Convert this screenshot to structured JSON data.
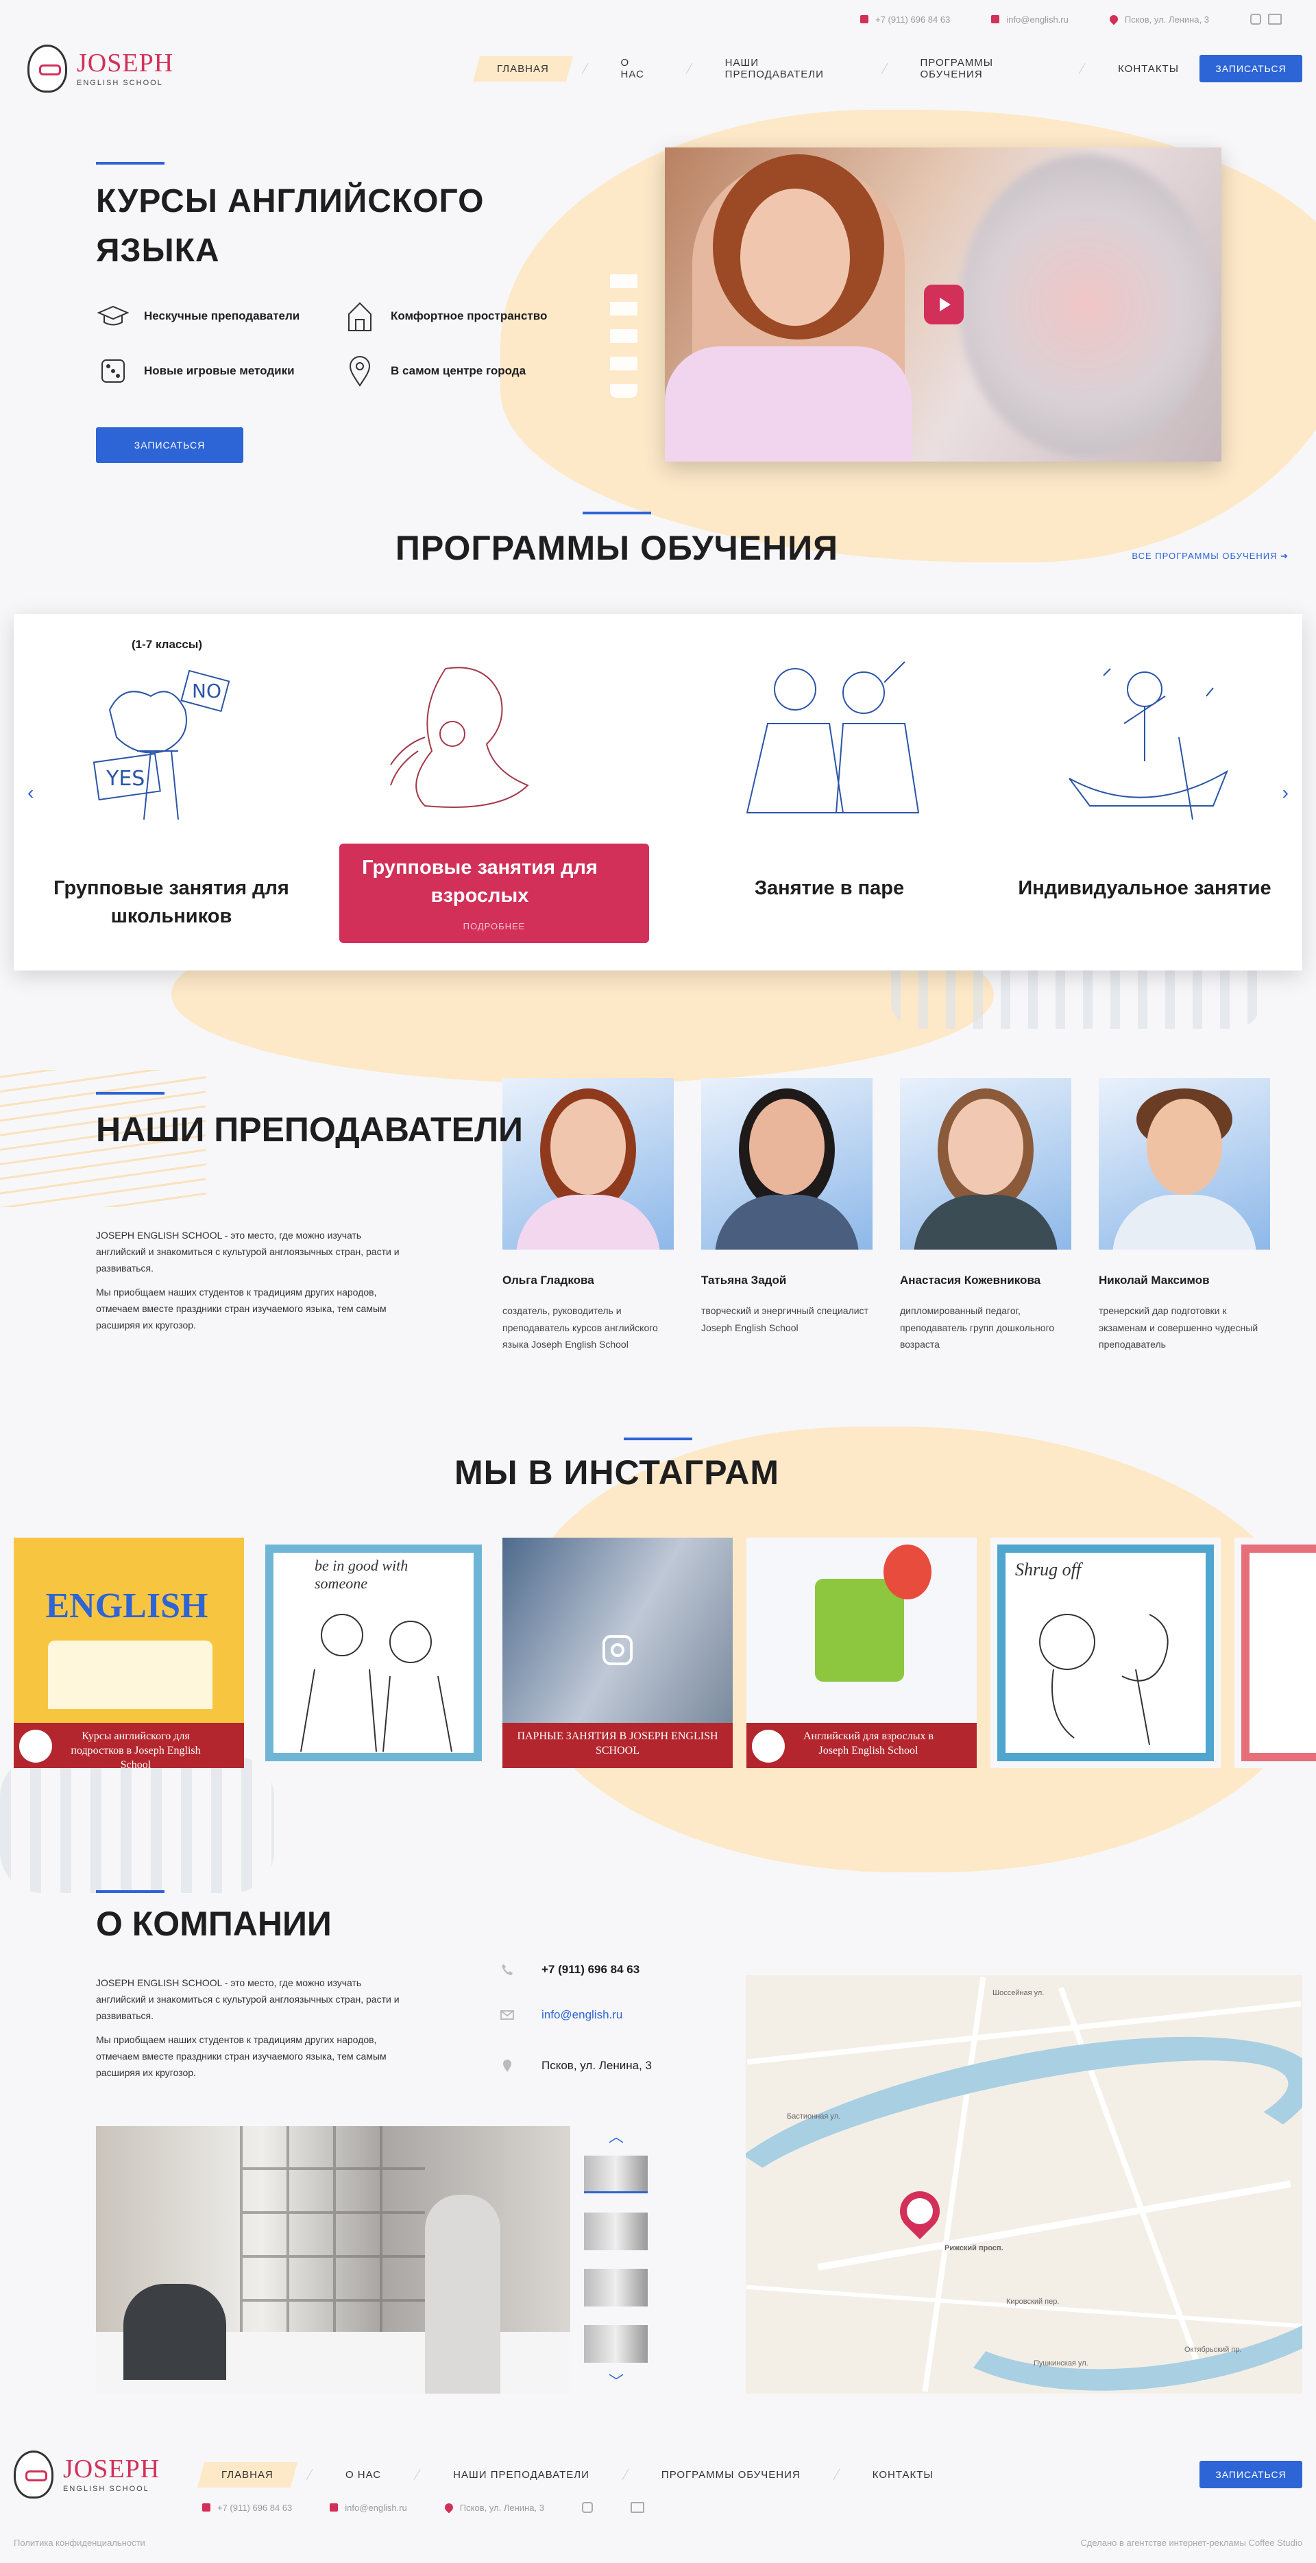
{
  "topbar": {
    "phone": "+7 (911) 696 84 63",
    "email": "info@english.ru",
    "address": "Псков, ул. Ленина, 3"
  },
  "logo": {
    "name": "JOSEPH",
    "sub": "ENGLISH SCHOOL"
  },
  "nav": [
    "Главная",
    "О нас",
    "Наши преподаватели",
    "Программы обучения",
    "Контакты"
  ],
  "cta": "Записаться",
  "hero": {
    "title": "Курсы английского языка",
    "features": [
      {
        "label": "Нескучные преподаватели",
        "icon": "graduation-cap-icon"
      },
      {
        "label": "Комфортное пространство",
        "icon": "house-icon"
      },
      {
        "label": "Новые игровые методики",
        "icon": "dice-icon"
      },
      {
        "label": "В самом центре города",
        "icon": "location-pin-icon"
      }
    ],
    "button": "Записаться"
  },
  "programs": {
    "title": "Программы обучения",
    "all_link": "Все программы обучения",
    "grade": "(1-7 классы)",
    "items": [
      {
        "name": "Групповые занятия для школьников"
      },
      {
        "name": "Групповые занятия для взрослых",
        "more": "Подробнее"
      },
      {
        "name": "Занятие в паре"
      },
      {
        "name": "Индивидуальное занятие"
      }
    ]
  },
  "teachers": {
    "title": "Наши преподаватели",
    "text": [
      "JOSEPH ENGLISH SCHOOL - это место, где можно изучать английский и знакомиться с культурой англоязычных стран, расти и развиваться.",
      "Мы приобщаем наших студентов к традициям других народов, отмечаем вместе праздники стран изучаемого языка, тем самым расширяя их кругозор."
    ],
    "list": [
      {
        "name": "Ольга Гладкова",
        "desc": "создатель, руководитель и преподаватель курсов английского языка Joseph English School"
      },
      {
        "name": "Татьяна Задой",
        "desc": "творческий и энергичный специалист Joseph English School"
      },
      {
        "name": "Анастасия Кожевникова",
        "desc": "дипломированный педагог, преподаватель групп дошкольного возраста"
      },
      {
        "name": "Николай Максимов",
        "desc": "тренерский дар подготовки к экзаменам и совершенно чудесный преподаватель"
      }
    ]
  },
  "instagram": {
    "title": "Мы в инстаграм",
    "posts": [
      {
        "caption": "Курсы английского для подростков в Joseph English School",
        "art": "ENGLISH"
      },
      {
        "caption": "",
        "art": "be in good with someone"
      },
      {
        "caption": "ПАРНЫЕ ЗАНЯТИЯ В JOSEPH ENGLISH SCHOOL",
        "art": ""
      },
      {
        "caption": "Английский для взрослых в Joseph English School",
        "art": ""
      },
      {
        "caption": "",
        "art": "Shrug off"
      }
    ]
  },
  "about": {
    "title": "О компании",
    "text": [
      "JOSEPH ENGLISH SCHOOL - это место, где можно изучать английский и знакомиться с культурой англоязычных стран, расти и развиваться.",
      "Мы приобщаем наших студентов к традициям других народов, отмечаем вместе праздники стран изучаемого языка, тем самым расширяя их кругозор."
    ],
    "phone": "+7 (911) 696 84 63",
    "email": "info@english.ru",
    "address": "Псков, ул. Ленина, 3"
  },
  "map": {
    "labels": [
      "Шоссейная ул.",
      "Рижский просп.",
      "Октябрьский пр.",
      "Кировский пер.",
      "Бастионная ул.",
      "Пушкинская ул."
    ]
  },
  "footer": {
    "privacy": "Политика конфиденциальности",
    "madeby": "Сделано в агентстве интернет-рекламы Coffee Studio"
  },
  "colors": {
    "accent": "#d23059",
    "blue": "#2d64d6",
    "peach": "#fde9c8"
  }
}
